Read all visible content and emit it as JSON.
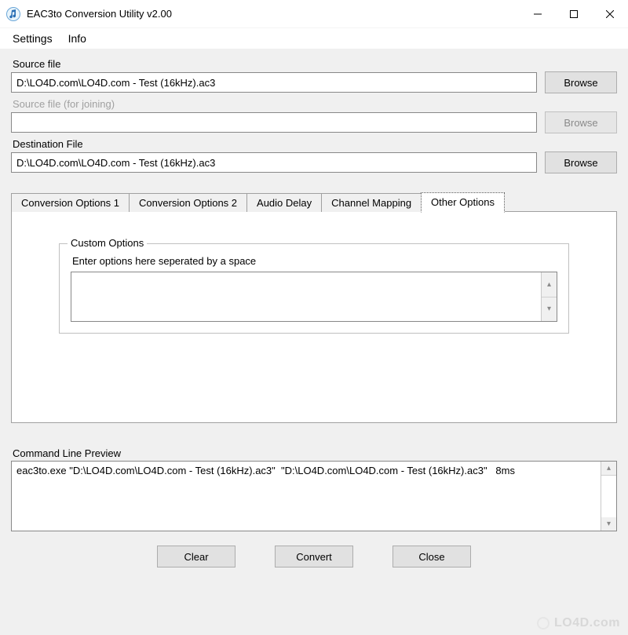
{
  "window": {
    "title": "EAC3to Conversion Utility  v2.00",
    "icon": "music-note-icon",
    "controls": {
      "minimize": "—",
      "maximize": "▢",
      "close": "✕"
    }
  },
  "menubar": {
    "settings": "Settings",
    "info": "Info"
  },
  "source": {
    "label": "Source file",
    "value": "D:\\LO4D.com\\LO4D.com - Test (16kHz).ac3",
    "browse": "Browse"
  },
  "source_join": {
    "label": "Source file (for joining)",
    "value": "",
    "browse": "Browse"
  },
  "destination": {
    "label": "Destination File",
    "value": "D:\\LO4D.com\\LO4D.com - Test (16kHz).ac3",
    "browse": "Browse"
  },
  "tabs": {
    "items": [
      {
        "label": "Conversion Options 1",
        "active": false
      },
      {
        "label": "Conversion Options 2",
        "active": false
      },
      {
        "label": "Audio Delay",
        "active": false
      },
      {
        "label": "Channel Mapping",
        "active": false
      },
      {
        "label": "Other Options",
        "active": true
      }
    ]
  },
  "custom_options": {
    "legend": "Custom Options",
    "hint": "Enter options here seperated by a space",
    "value": ""
  },
  "command_preview": {
    "label": "Command Line Preview",
    "value": "eac3to.exe \"D:\\LO4D.com\\LO4D.com - Test (16kHz).ac3\"  \"D:\\LO4D.com\\LO4D.com - Test (16kHz).ac3\"   8ms"
  },
  "buttons": {
    "clear": "Clear",
    "convert": "Convert",
    "close": "Close"
  },
  "watermark": "LO4D.com"
}
